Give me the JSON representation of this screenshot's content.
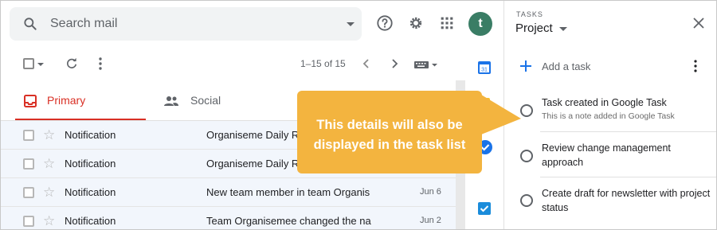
{
  "search": {
    "placeholder": "Search mail"
  },
  "header": {
    "avatar_letter": "t"
  },
  "toolbar": {
    "range": "1–15 of 15"
  },
  "tabs": [
    {
      "label": "Primary",
      "active": true
    },
    {
      "label": "Social",
      "active": false
    }
  ],
  "messages": [
    {
      "sender": "Notification",
      "subject": "Organiseme Daily Re",
      "date": ""
    },
    {
      "sender": "Notification",
      "subject": "Organiseme Daily Re",
      "date": ""
    },
    {
      "sender": "Notification",
      "subject": "New team member in team Organis",
      "date": "Jun 6"
    },
    {
      "sender": "Notification",
      "subject": "Team Organisemee changed the na",
      "date": "Jun 2"
    }
  ],
  "tasks_panel": {
    "section_label": "TASKS",
    "list_name": "Project",
    "add_label": "Add a task",
    "tasks": [
      {
        "title": "Task created in Google Task",
        "note": "This is a note added in Google Task"
      },
      {
        "title": "Review change management approach",
        "note": ""
      },
      {
        "title": "Create draft for newsletter with project status",
        "note": ""
      }
    ]
  },
  "callout": {
    "text": "This details will also be displayed in the task list"
  },
  "rail": {
    "calendar_day": "31"
  },
  "colors": {
    "accent_red": "#d93025",
    "callout": "#f3b43f",
    "avatar": "#3a7d65",
    "blue": "#1a73e8"
  }
}
